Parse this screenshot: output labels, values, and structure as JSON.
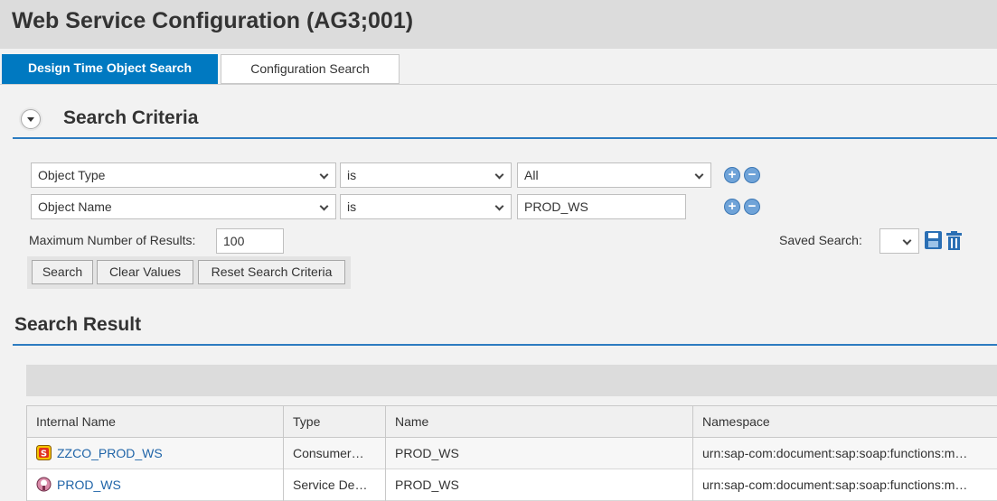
{
  "title": "Web Service Configuration (AG3;001)",
  "tabs": [
    {
      "label": "Design Time Object Search",
      "active": true
    },
    {
      "label": "Configuration Search",
      "active": false
    }
  ],
  "criteria": {
    "header": "Search Criteria",
    "rows": [
      {
        "field": "Object Type",
        "operator": "is",
        "value": "All",
        "value_is_dropdown": true
      },
      {
        "field": "Object Name",
        "operator": "is",
        "value": "PROD_WS",
        "value_is_dropdown": false
      }
    ],
    "max_results_label": "Maximum Number of Results:",
    "max_results_value": "100",
    "saved_search_label": "Saved Search:",
    "saved_search_value": "",
    "buttons": {
      "search": "Search",
      "clear": "Clear Values",
      "reset": "Reset Search Criteria"
    },
    "add_symbol": "+",
    "remove_symbol": "−"
  },
  "result": {
    "header": "Search Result",
    "columns": [
      "Internal Name",
      "Type",
      "Name",
      "Namespace"
    ],
    "rows": [
      {
        "internal_name": "ZZCO_PROD_WS",
        "icon": "consumer-proxy-icon",
        "type": "Consumer…",
        "name": "PROD_WS",
        "namespace": "urn:sap-com:document:sap:soap:functions:m…"
      },
      {
        "internal_name": "PROD_WS",
        "icon": "service-definition-icon",
        "type": "Service De…",
        "name": "PROD_WS",
        "namespace": "urn:sap-com:document:sap:soap:functions:m…"
      }
    ]
  },
  "colors": {
    "accent": "#0079c1",
    "section_line": "#2d7cc1",
    "link": "#1f64a8"
  }
}
